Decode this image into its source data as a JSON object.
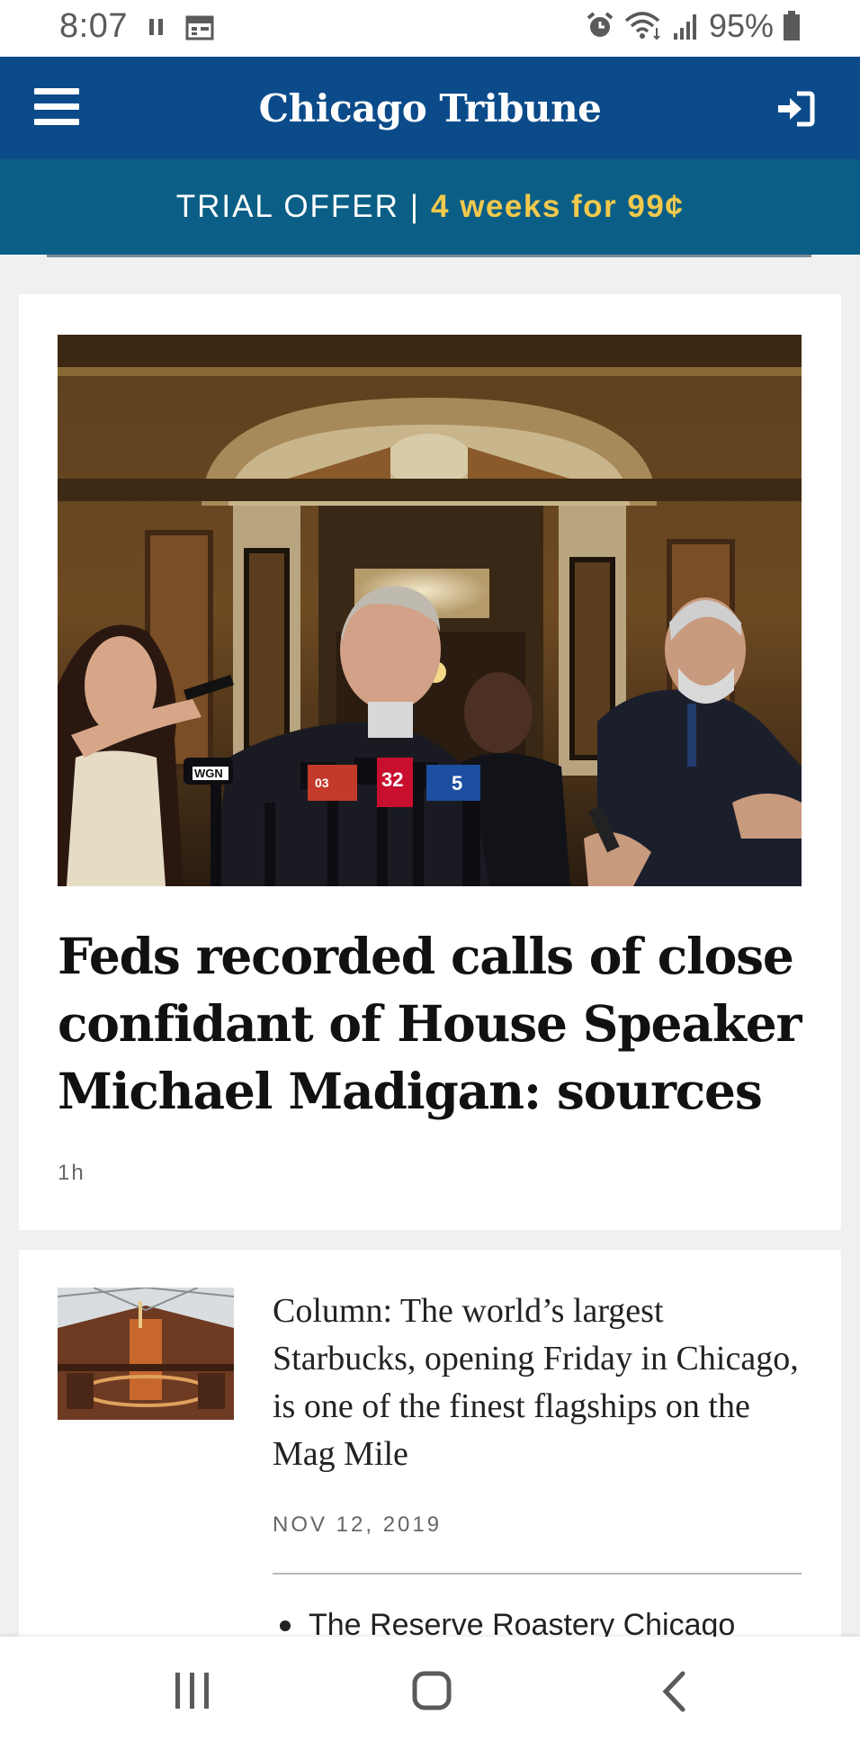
{
  "status_bar": {
    "time": "8:07",
    "battery": "95%",
    "icons": [
      "pause-icon",
      "calendar-icon",
      "alarm-icon",
      "wifi-icon",
      "signal-icon",
      "battery-icon"
    ]
  },
  "header": {
    "brand": "Chicago Tribune",
    "menu_icon": "hamburger-menu-icon",
    "signin_icon": "sign-in-icon",
    "background": "#0c4b8a"
  },
  "trial_offer": {
    "label": "TRIAL OFFER",
    "separator": "|",
    "offer": "4 weeks for 99¢",
    "background": "#0b5f86",
    "highlight_color": "#f2c94c"
  },
  "lead_story": {
    "headline": "Feds recorded calls of close confidant of House Speaker Michael Madigan: sources",
    "time_ago": "1h",
    "image": {
      "mic_flags": [
        "WGN",
        "WCIA 3 NEWS",
        "FOX 32 NEWS",
        "NBC 5 NEWS"
      ]
    }
  },
  "second_story": {
    "headline": "Column: The world’s largest Starbucks, opening Friday in Chicago, is one of the finest flagships on the Mag Mile",
    "date": "NOV 12, 2019",
    "related": [
      "The Reserve Roastery Chicago"
    ]
  },
  "nav_bar": {
    "icons": [
      "recent-apps-icon",
      "home-icon",
      "back-icon"
    ]
  }
}
